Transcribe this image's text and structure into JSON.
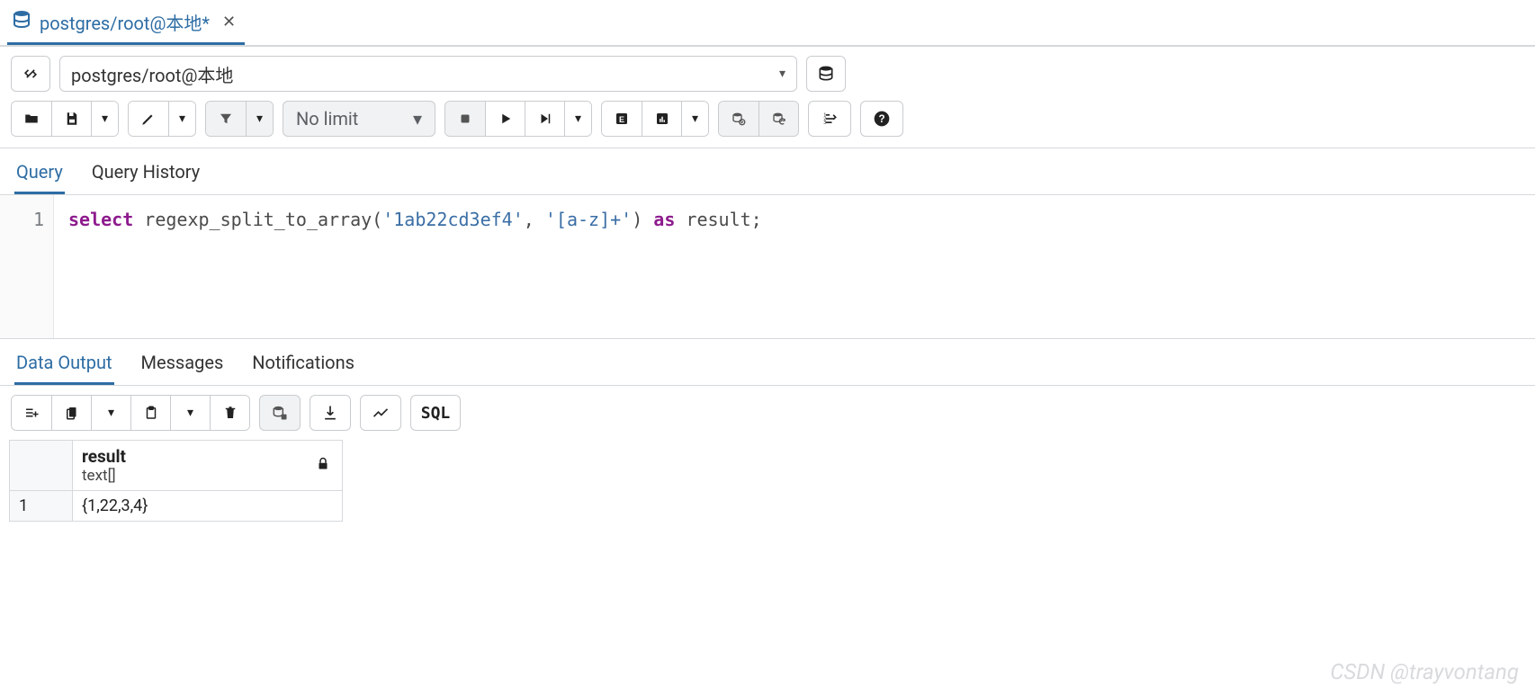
{
  "topTab": {
    "label": "postgres/root@本地*"
  },
  "connection": {
    "value": "postgres/root@本地"
  },
  "toolbar": {
    "limit": "No limit"
  },
  "editorTabs": {
    "query": "Query",
    "history": "Query History"
  },
  "editor": {
    "line_numbers": [
      "1"
    ],
    "sql_tokens": {
      "select": "select",
      "fn": "regexp_split_to_array",
      "open": "(",
      "arg1": "'1ab22cd3ef4'",
      "comma": ", ",
      "arg2": "'[a-z]+'",
      "close": ")",
      "as": "as",
      "alias": "result",
      "semi": ";"
    }
  },
  "resultTabs": {
    "data": "Data Output",
    "messages": "Messages",
    "notifications": "Notifications"
  },
  "resultsToolbar": {
    "sql": "SQL"
  },
  "resultsGrid": {
    "column": {
      "name": "result",
      "type": "text[]"
    },
    "rows": [
      {
        "n": "1",
        "value": "{1,22,3,4}"
      }
    ]
  },
  "watermark": "CSDN @trayvontang"
}
